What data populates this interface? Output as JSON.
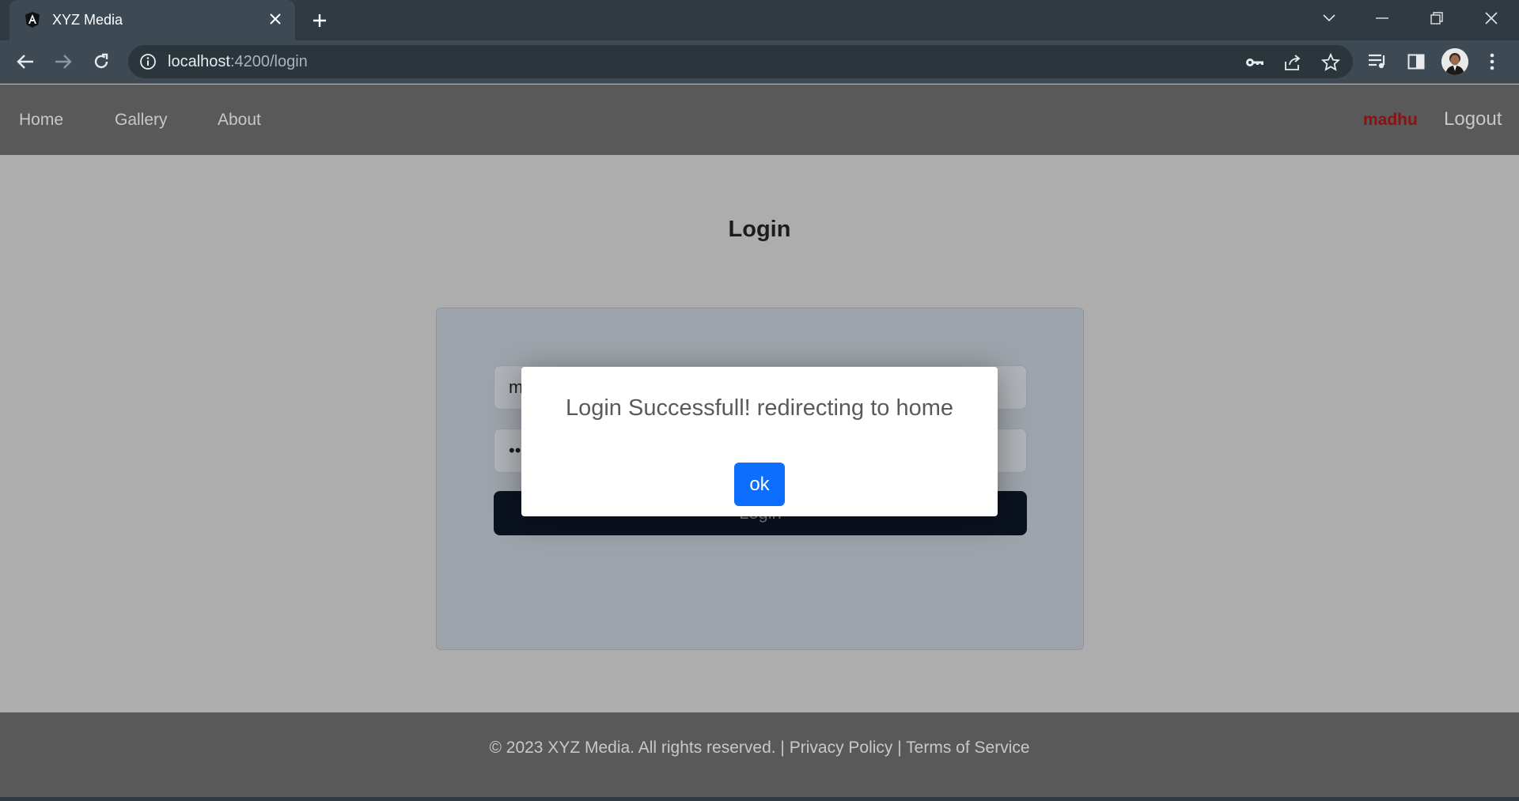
{
  "browser": {
    "tab_title": "XYZ Media",
    "url_host": "localhost",
    "url_rest": ":4200/login"
  },
  "nav": {
    "links": [
      "Home",
      "Gallery",
      "About"
    ],
    "username": "madhu",
    "logout": "Logout"
  },
  "main": {
    "heading": "Login",
    "username_value": "m",
    "password_value": "••",
    "login_button": "Login"
  },
  "modal": {
    "message": "Login Successfull! redirecting to home",
    "ok_button": "ok"
  },
  "footer": {
    "copyright": "© 2023 XYZ Media. All rights reserved.",
    "separator": " | ",
    "privacy": "Privacy Policy",
    "terms": "Terms of Service"
  },
  "colors": {
    "navbar": "#595959",
    "page_bg": "#adadad",
    "username": "#8e1010",
    "ok_button": "#0d6efd",
    "login_button": "#0b1320"
  },
  "icons": [
    "angular-favicon-icon",
    "close-icon",
    "plus-icon",
    "chevron-down-icon",
    "minimize-icon",
    "restore-icon",
    "back-icon",
    "forward-icon",
    "reload-icon",
    "info-icon",
    "key-icon",
    "share-icon",
    "star-icon",
    "media-icon",
    "sidepanel-icon",
    "menu-icon"
  ]
}
